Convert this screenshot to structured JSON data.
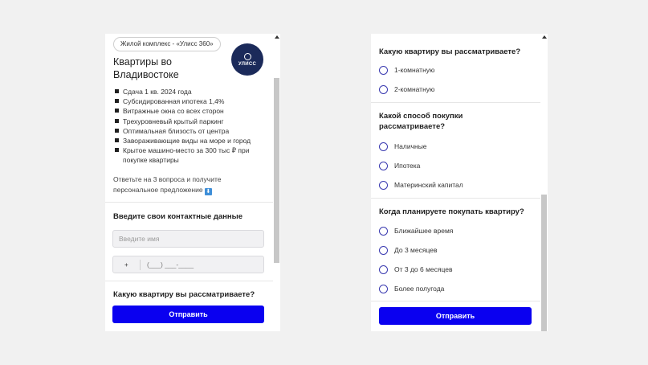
{
  "left": {
    "badge": "Жилой комплекс - «Улисс 360»",
    "logo_text": "УЛИСС",
    "title": "Квартиры во Владивостоке",
    "features": [
      "Сдача 1 кв. 2024 года",
      "Субсидированная ипотека 1,4%",
      "Витражные окна со всех сторон",
      "Трехуровневый крытый паркинг",
      "Оптимальная близость от центра",
      "Завораживающие виды на море и город",
      "Крытое машино-место за 300 тыс ₽ при покупке квартиры"
    ],
    "promo": "Ответьте на 3 вопроса и получите персональное предложение",
    "promo_emoji": "⬇",
    "contact_title": "Введите свои контактные данные",
    "name_placeholder": "Введите имя",
    "phone_prefix": "+",
    "phone_mask": "(___) ___-____",
    "question_title": "Какую квартиру вы рассматриваете?",
    "submit_label": "Отправить"
  },
  "right": {
    "q1": {
      "title": "Какую квартиру вы рассматриваете?",
      "options": [
        "1-комнатную",
        "2-комнатную"
      ]
    },
    "q2": {
      "title": "Какой способ покупки рассматриваете?",
      "options": [
        "Наличные",
        "Ипотека",
        "Материнский капитал"
      ]
    },
    "q3": {
      "title": "Когда планируете покупать квартиру?",
      "options": [
        "Ближайшее время",
        "До 3 месяцев",
        "От 3 до 6 месяцев",
        "Более полугода"
      ]
    },
    "submit_label": "Отправить"
  },
  "colors": {
    "accent": "#0a00f0",
    "logo_bg": "#1b2a5a",
    "radio": "#3a3ab0",
    "background": "#f1f1f1"
  }
}
